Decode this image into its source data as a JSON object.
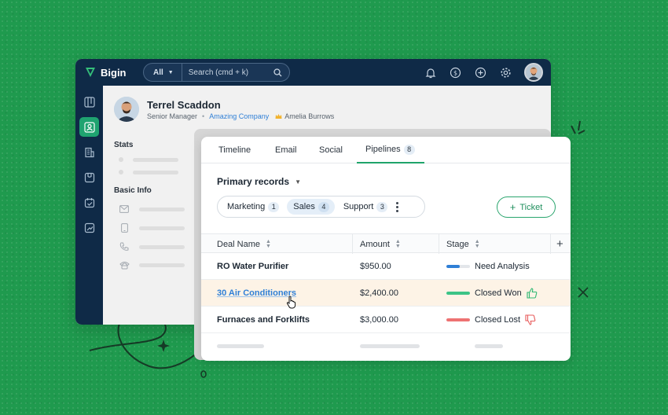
{
  "app": {
    "brand": "Bigin",
    "search": {
      "filter": "All",
      "placeholder": "Search (cmd + k)"
    }
  },
  "profile": {
    "name": "Terrel Scaddon",
    "title": "Senior Manager",
    "company": "Amazing Company",
    "owner": "Amelia Burrows"
  },
  "sections": {
    "stats": "Stats",
    "basic_info": "Basic Info"
  },
  "tabs": [
    {
      "label": "Timeline"
    },
    {
      "label": "Email"
    },
    {
      "label": "Social"
    },
    {
      "label": "Pipelines",
      "count": "8",
      "active": true
    }
  ],
  "records": {
    "title": "Primary records",
    "pipelines": [
      {
        "label": "Marketing",
        "count": "1"
      },
      {
        "label": "Sales",
        "count": "4",
        "active": true
      },
      {
        "label": "Support",
        "count": "3"
      }
    ],
    "add_button": "Ticket"
  },
  "table": {
    "columns": [
      "Deal Name",
      "Amount",
      "Stage"
    ],
    "rows": [
      {
        "deal": "RO Water Purifier",
        "amount": "$950.00",
        "stage": "Need Analysis",
        "stage_color": "#2f7fd6",
        "stage_progress": 0.55,
        "outcome": ""
      },
      {
        "deal": "30 Air Conditioners",
        "amount": "$2,400.00",
        "stage": "Closed Won",
        "stage_color": "#3cc486",
        "stage_progress": 1.0,
        "outcome": "thumbs-up-icon"
      },
      {
        "deal": "Furnaces and Forklifts",
        "amount": "$3,000.00",
        "stage": "Closed Lost",
        "stage_color": "#ee7272",
        "stage_progress": 1.0,
        "outcome": "thumbs-down-icon"
      }
    ]
  },
  "colors": {
    "brand_green": "#20a46b",
    "nav_dark": "#0f2a47",
    "link_blue": "#2f7fd6",
    "background": "#1f9a4e"
  }
}
